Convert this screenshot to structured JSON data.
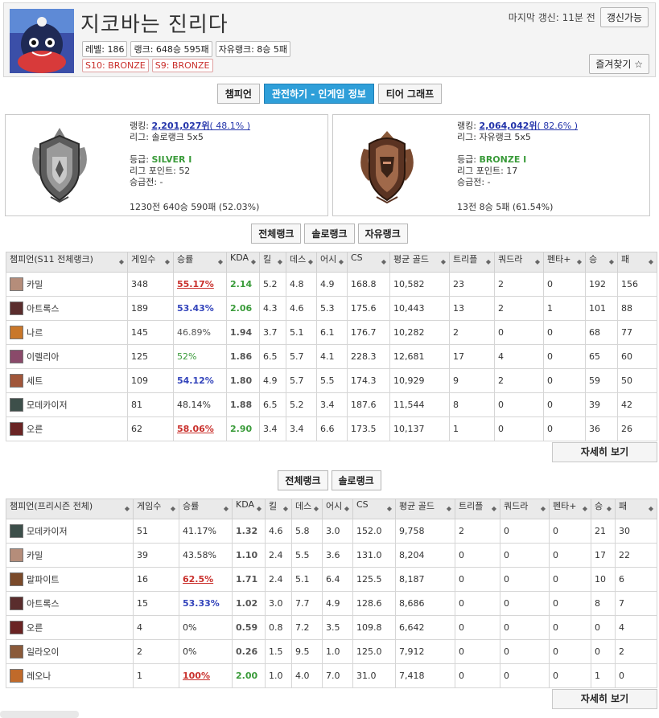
{
  "profile": {
    "name": "지코바는 진리다",
    "level": "레벨: 186",
    "rank_record": "랭크: 648승 595패",
    "flex_record": "자유랭크: 8승 5패",
    "past_tiers": [
      "S10: BRONZE",
      "S9: BRONZE"
    ],
    "last_update": "마지막 갱신: 11분 전",
    "refresh_label": "갱신가능",
    "favorite_label": "즐겨찾기 ☆"
  },
  "nav": {
    "tabs": [
      "챔피언",
      "관전하기 - 인게임 정보",
      "티어 그래프"
    ],
    "active": 1
  },
  "solo": {
    "ranking_label": "랭킹: ",
    "ranking": "2,201,027위",
    "ranking_pct": "( 48.1% )",
    "league": "리그: 솔로랭크 5x5",
    "tier_label": "등급: ",
    "tier": "SILVER I",
    "lp": "리그 포인트: 52",
    "promo": "승급전: -",
    "record": "1230전 640승 590패 (52.03%)"
  },
  "flex": {
    "ranking_label": "랭킹: ",
    "ranking": "2,064,042위",
    "ranking_pct": "( 82.6% )",
    "league": "리그: 자유랭크 5x5",
    "tier_label": "등급: ",
    "tier": "BRONZE I",
    "lp": "리그 포인트: 17",
    "promo": "승급전: -",
    "record": "13전 8승 5패 (61.54%)"
  },
  "tabs1": [
    "전체랭크",
    "솔로랭크",
    "자유랭크"
  ],
  "tabs2": [
    "전체랭크",
    "솔로랭크"
  ],
  "table1": {
    "headers": [
      "챔피언(S11 전체랭크)",
      "게임수",
      "승률",
      "KDA",
      "킬",
      "데스",
      "어시",
      "CS",
      "평균 골드",
      "트리플",
      "쿼드라",
      "펜타+",
      "승",
      "패"
    ],
    "rows": [
      {
        "name": "카밀",
        "games": "348",
        "wr": "55.17%",
        "wr_style": "red",
        "kda": "2.14",
        "kda_style": "g",
        "k": "5.2",
        "d": "4.8",
        "a": "4.9",
        "cs": "168.8",
        "gold": "10,582",
        "triple": "23",
        "quadra": "2",
        "penta": "0",
        "w": "192",
        "l": "156",
        "color": "#b58d7a"
      },
      {
        "name": "아트록스",
        "games": "189",
        "wr": "53.43%",
        "wr_style": "blue",
        "kda": "2.06",
        "kda_style": "g",
        "k": "4.3",
        "d": "4.6",
        "a": "5.3",
        "cs": "175.6",
        "gold": "10,443",
        "triple": "13",
        "quadra": "2",
        "penta": "1",
        "w": "101",
        "l": "88",
        "color": "#5a2d2d"
      },
      {
        "name": "나르",
        "games": "145",
        "wr": "46.89%",
        "wr_style": "gray",
        "kda": "1.94",
        "kda_style": "n",
        "k": "3.7",
        "d": "5.1",
        "a": "6.1",
        "cs": "176.7",
        "gold": "10,282",
        "triple": "2",
        "quadra": "0",
        "penta": "0",
        "w": "68",
        "l": "77",
        "color": "#c9772a"
      },
      {
        "name": "이렐리아",
        "games": "125",
        "wr": "52%",
        "wr_style": "green",
        "kda": "1.86",
        "kda_style": "n",
        "k": "6.5",
        "d": "5.7",
        "a": "4.1",
        "cs": "228.3",
        "gold": "12,681",
        "triple": "17",
        "quadra": "4",
        "penta": "0",
        "w": "65",
        "l": "60",
        "color": "#8a4a6a"
      },
      {
        "name": "세트",
        "games": "109",
        "wr": "54.12%",
        "wr_style": "blue",
        "kda": "1.80",
        "kda_style": "n",
        "k": "4.9",
        "d": "5.7",
        "a": "5.5",
        "cs": "174.3",
        "gold": "10,929",
        "triple": "9",
        "quadra": "2",
        "penta": "0",
        "w": "59",
        "l": "50",
        "color": "#a0563a"
      },
      {
        "name": "모데카이저",
        "games": "81",
        "wr": "48.14%",
        "wr_style": "plain",
        "kda": "1.88",
        "kda_style": "n",
        "k": "6.5",
        "d": "5.2",
        "a": "3.4",
        "cs": "187.6",
        "gold": "11,544",
        "triple": "8",
        "quadra": "0",
        "penta": "0",
        "w": "39",
        "l": "42",
        "color": "#3d4f4a"
      },
      {
        "name": "오른",
        "games": "62",
        "wr": "58.06%",
        "wr_style": "red",
        "kda": "2.90",
        "kda_style": "g",
        "k": "3.4",
        "d": "3.4",
        "a": "6.6",
        "cs": "173.5",
        "gold": "10,137",
        "triple": "1",
        "quadra": "0",
        "penta": "0",
        "w": "36",
        "l": "26",
        "color": "#6a2424"
      }
    ]
  },
  "table2": {
    "headers": [
      "챔피언(프리시즌 전체)",
      "게임수",
      "승률",
      "KDA",
      "킬",
      "데스",
      "어시",
      "CS",
      "평균 골드",
      "트리플",
      "쿼드라",
      "펜타+",
      "승",
      "패"
    ],
    "rows": [
      {
        "name": "모데카이저",
        "games": "51",
        "wr": "41.17%",
        "wr_style": "plain",
        "kda": "1.32",
        "kda_style": "n",
        "k": "4.6",
        "d": "5.8",
        "a": "3.0",
        "cs": "152.0",
        "gold": "9,758",
        "triple": "2",
        "quadra": "0",
        "penta": "0",
        "w": "21",
        "l": "30",
        "color": "#3d4f4a"
      },
      {
        "name": "카밀",
        "games": "39",
        "wr": "43.58%",
        "wr_style": "plain",
        "kda": "1.10",
        "kda_style": "n",
        "k": "2.4",
        "d": "5.5",
        "a": "3.6",
        "cs": "131.0",
        "gold": "8,204",
        "triple": "0",
        "quadra": "0",
        "penta": "0",
        "w": "17",
        "l": "22",
        "color": "#b58d7a"
      },
      {
        "name": "말파이트",
        "games": "16",
        "wr": "62.5%",
        "wr_style": "red",
        "kda": "1.71",
        "kda_style": "n",
        "k": "2.4",
        "d": "5.1",
        "a": "6.4",
        "cs": "125.5",
        "gold": "8,187",
        "triple": "0",
        "quadra": "0",
        "penta": "0",
        "w": "10",
        "l": "6",
        "color": "#7a4a2a"
      },
      {
        "name": "아트록스",
        "games": "15",
        "wr": "53.33%",
        "wr_style": "blue",
        "kda": "1.02",
        "kda_style": "n",
        "k": "3.0",
        "d": "7.7",
        "a": "4.9",
        "cs": "128.6",
        "gold": "8,686",
        "triple": "0",
        "quadra": "0",
        "penta": "0",
        "w": "8",
        "l": "7",
        "color": "#5a2d2d"
      },
      {
        "name": "오른",
        "games": "4",
        "wr": "0%",
        "wr_style": "plain",
        "kda": "0.59",
        "kda_style": "n",
        "k": "0.8",
        "d": "7.2",
        "a": "3.5",
        "cs": "109.8",
        "gold": "6,642",
        "triple": "0",
        "quadra": "0",
        "penta": "0",
        "w": "0",
        "l": "4",
        "color": "#6a2424"
      },
      {
        "name": "일라오이",
        "games": "2",
        "wr": "0%",
        "wr_style": "plain",
        "kda": "0.26",
        "kda_style": "n",
        "k": "1.5",
        "d": "9.5",
        "a": "1.0",
        "cs": "125.0",
        "gold": "7,912",
        "triple": "0",
        "quadra": "0",
        "penta": "0",
        "w": "0",
        "l": "2",
        "color": "#8a5a3a"
      },
      {
        "name": "레오나",
        "games": "1",
        "wr": "100%",
        "wr_style": "red",
        "kda": "2.00",
        "kda_style": "g",
        "k": "1.0",
        "d": "4.0",
        "a": "7.0",
        "cs": "31.0",
        "gold": "7,418",
        "triple": "0",
        "quadra": "0",
        "penta": "0",
        "w": "1",
        "l": "0",
        "color": "#c06a2a"
      }
    ]
  },
  "more_label": "자세히 보기",
  "icons": {
    "sort": "sort-icon",
    "avatar": "profile-avatar",
    "solo_emblem": "silver-emblem",
    "flex_emblem": "bronze-emblem"
  }
}
